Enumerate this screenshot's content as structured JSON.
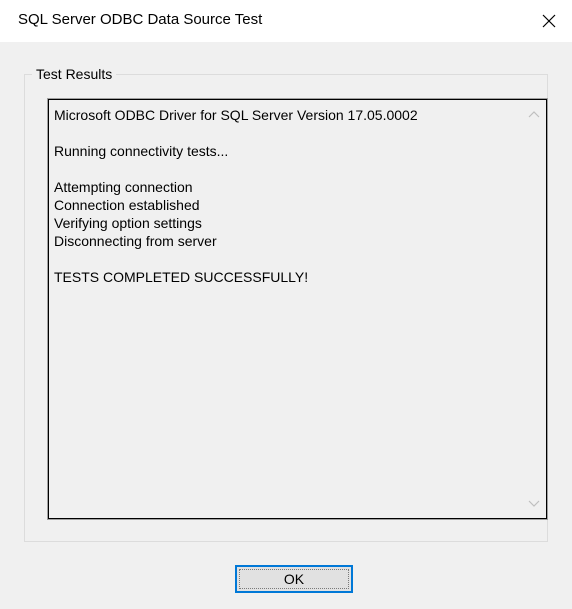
{
  "window": {
    "title": "SQL Server ODBC Data Source Test",
    "close_icon": "close-icon"
  },
  "group": {
    "legend": "Test Results"
  },
  "results": {
    "lines": [
      "Microsoft ODBC Driver for SQL Server Version 17.05.0002",
      "",
      "Running connectivity tests...",
      "",
      "Attempting connection",
      "Connection established",
      "Verifying option settings",
      "Disconnecting from server",
      "",
      "TESTS COMPLETED SUCCESSFULLY!"
    ],
    "scroll_up_icon": "chevron-up-icon",
    "scroll_down_icon": "chevron-down-icon"
  },
  "buttons": {
    "ok_label": "OK"
  },
  "colors": {
    "dialog_bg": "#f0f0f0",
    "titlebar_bg": "#ffffff",
    "focus_border": "#0078d7",
    "button_bg": "#e1e1e1"
  }
}
